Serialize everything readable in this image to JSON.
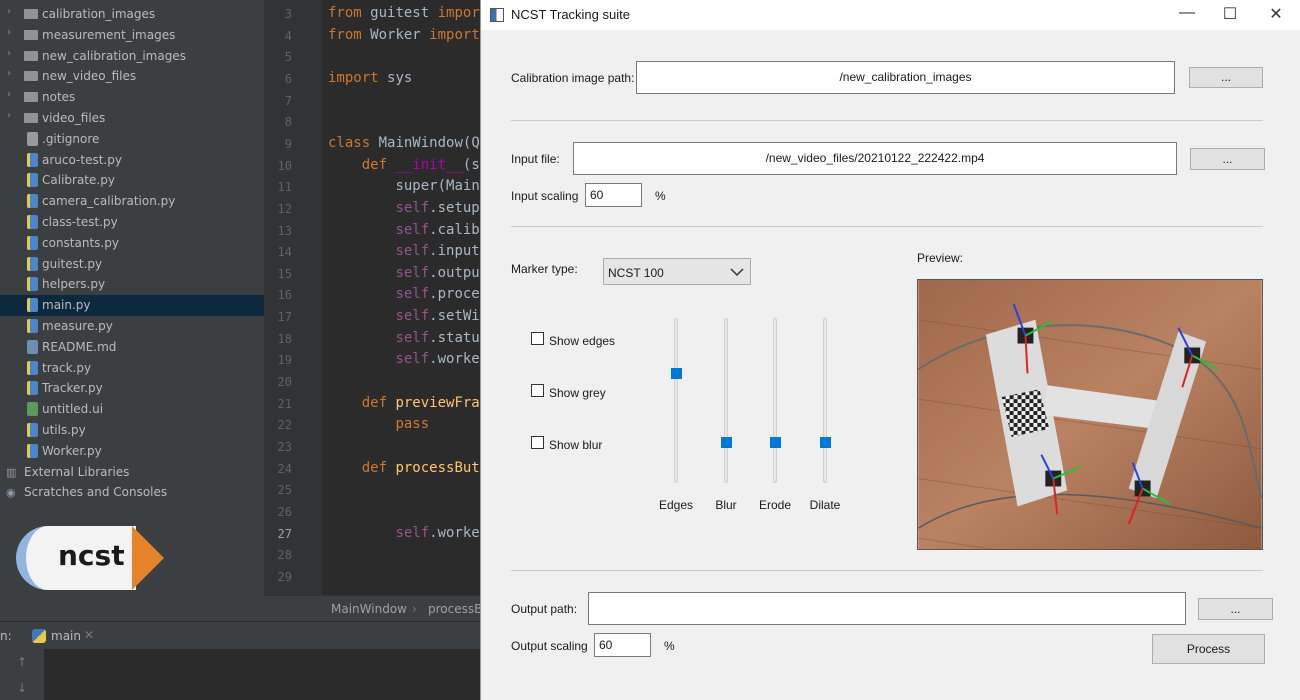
{
  "ide": {
    "tree": [
      {
        "kind": "folder",
        "label": "calibration_images"
      },
      {
        "kind": "folder",
        "label": "measurement_images"
      },
      {
        "kind": "folder",
        "label": "new_calibration_images"
      },
      {
        "kind": "folder",
        "label": "new_video_files"
      },
      {
        "kind": "folder",
        "label": "notes"
      },
      {
        "kind": "folder",
        "label": "video_files"
      },
      {
        "kind": "file",
        "label": ".gitignore"
      },
      {
        "kind": "py",
        "label": "aruco-test.py"
      },
      {
        "kind": "py",
        "label": "Calibrate.py"
      },
      {
        "kind": "py",
        "label": "camera_calibration.py"
      },
      {
        "kind": "py",
        "label": "class-test.py"
      },
      {
        "kind": "py",
        "label": "constants.py"
      },
      {
        "kind": "py",
        "label": "guitest.py"
      },
      {
        "kind": "py",
        "label": "helpers.py"
      },
      {
        "kind": "py",
        "label": "main.py"
      },
      {
        "kind": "py",
        "label": "measure.py"
      },
      {
        "kind": "md",
        "label": "README.md"
      },
      {
        "kind": "py",
        "label": "track.py"
      },
      {
        "kind": "py",
        "label": "Tracker.py"
      },
      {
        "kind": "ui",
        "label": "untitled.ui"
      },
      {
        "kind": "py",
        "label": "utils.py"
      },
      {
        "kind": "py",
        "label": "Worker.py"
      },
      {
        "kind": "lib",
        "label": "External Libraries"
      },
      {
        "kind": "scratch",
        "label": "Scratches and Consoles"
      }
    ],
    "line_numbers": [
      "3",
      "4",
      "5",
      "6",
      "7",
      "8",
      "9",
      "10",
      "11",
      "12",
      "13",
      "14",
      "15",
      "16",
      "17",
      "18",
      "19",
      "20",
      "21",
      "22",
      "23",
      "24",
      "25",
      "26",
      "27",
      "28",
      "29"
    ],
    "code_lines": [
      "from guitest import",
      "from Worker import",
      "",
      "import sys",
      "",
      "",
      "class MainWindow(Qt",
      "    def __init__(se",
      "        super(MainW",
      "        self.setupU",
      "        self.calibr",
      "        self.inputF",
      "        self.output",
      "        self.proces",
      "        self.setWin",
      "        self.status",
      "        self.worker",
      "",
      "    def previewFram",
      "        pass",
      "",
      "    def processButt",
      "",
      "",
      "        self.worker",
      "",
      ""
    ],
    "breadcrumb": [
      "MainWindow",
      "processBu"
    ],
    "run": {
      "prefix": "n:",
      "tab": "main"
    },
    "logo_text": "ncst"
  },
  "app": {
    "title": "NCST Tracking suite",
    "calibration": {
      "label": "Calibration image path:",
      "value": "/new_calibration_images",
      "browse": "..."
    },
    "input": {
      "label": "Input file:",
      "value": "/new_video_files/20210122_222422.mp4",
      "browse": "...",
      "scaling_label": "Input scaling",
      "scaling_value": "60",
      "unit": "%"
    },
    "marker": {
      "label": "Marker type:",
      "value": "NCST 100"
    },
    "checkboxes": [
      {
        "label": "Show edges",
        "checked": false
      },
      {
        "label": "Show grey",
        "checked": false
      },
      {
        "label": "Show blur",
        "checked": false
      }
    ],
    "sliders": [
      {
        "label": "Edges",
        "level": 0.67
      },
      {
        "label": "Blur",
        "level": 0.22
      },
      {
        "label": "Erode",
        "level": 0.22
      },
      {
        "label": "Dilate",
        "level": 0.22
      }
    ],
    "preview_label": "Preview:",
    "output": {
      "label": "Output path:",
      "value": "",
      "browse": "...",
      "scaling_label": "Output scaling",
      "scaling_value": "60",
      "unit": "%"
    },
    "process": "Process",
    "accent": "#0078d7"
  }
}
